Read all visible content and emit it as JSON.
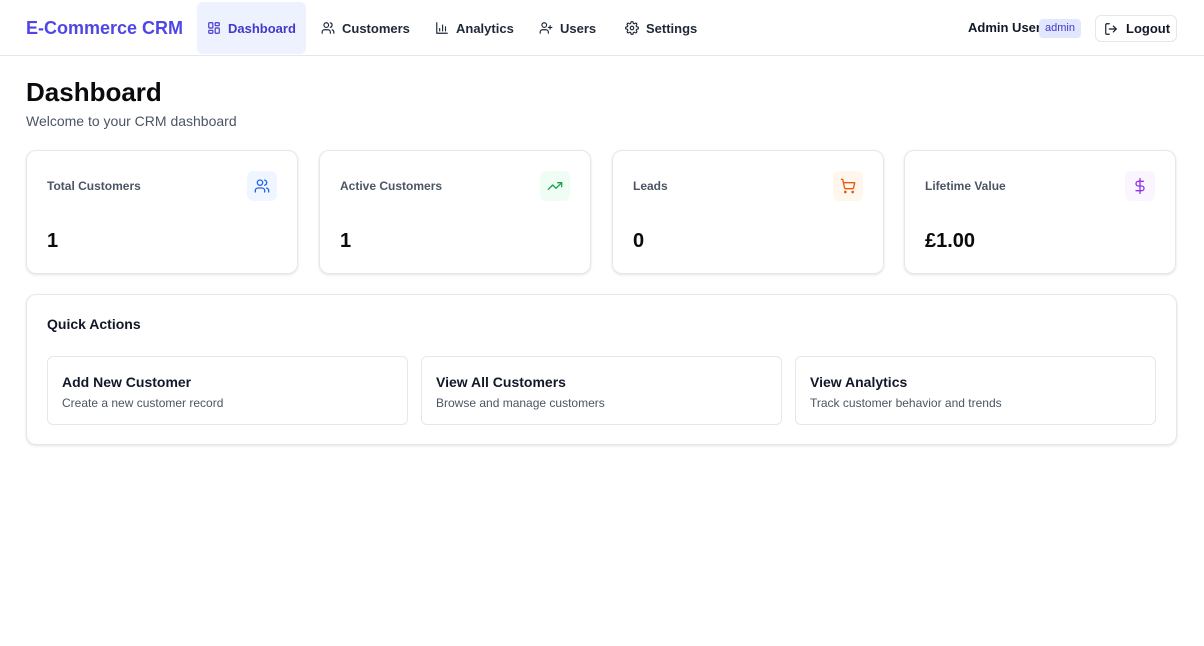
{
  "app": {
    "brand": "E-Commerce CRM"
  },
  "nav": {
    "items": [
      {
        "label": "Dashboard",
        "icon": "layout-grid-icon",
        "active": true
      },
      {
        "label": "Customers",
        "icon": "users-icon"
      },
      {
        "label": "Analytics",
        "icon": "bar-chart-icon"
      },
      {
        "label": "Users",
        "icon": "user-plus-icon"
      },
      {
        "label": "Settings",
        "icon": "gear-icon"
      }
    ]
  },
  "user": {
    "name": "Admin User",
    "role": "admin",
    "logout_label": "Logout"
  },
  "page": {
    "title": "Dashboard",
    "subtitle": "Welcome to your CRM dashboard"
  },
  "stats": [
    {
      "label": "Total Customers",
      "value": "1",
      "icon": "users-icon",
      "accent": "#2563eb",
      "icon_bg": "#eff6ff"
    },
    {
      "label": "Active Customers",
      "value": "1",
      "icon": "trending-up-icon",
      "accent": "#16a34a",
      "icon_bg": "#f0fdf4"
    },
    {
      "label": "Leads",
      "value": "0",
      "icon": "shopping-cart-icon",
      "accent": "#ea580c",
      "icon_bg": "#fff7ed"
    },
    {
      "label": "Lifetime Value",
      "value": "£1.00",
      "icon": "dollar-icon",
      "accent": "#9333ea",
      "icon_bg": "#faf5ff"
    }
  ],
  "quick_actions": {
    "title": "Quick Actions",
    "items": [
      {
        "title": "Add New Customer",
        "description": "Create a new customer record"
      },
      {
        "title": "View All Customers",
        "description": "Browse and manage customers"
      },
      {
        "title": "View Analytics",
        "description": "Track customer behavior and trends"
      }
    ]
  },
  "colors": {
    "brand": "#4f46e5",
    "nav_active_bg": "#eef2ff",
    "badge_bg": "#e0e7ff"
  }
}
